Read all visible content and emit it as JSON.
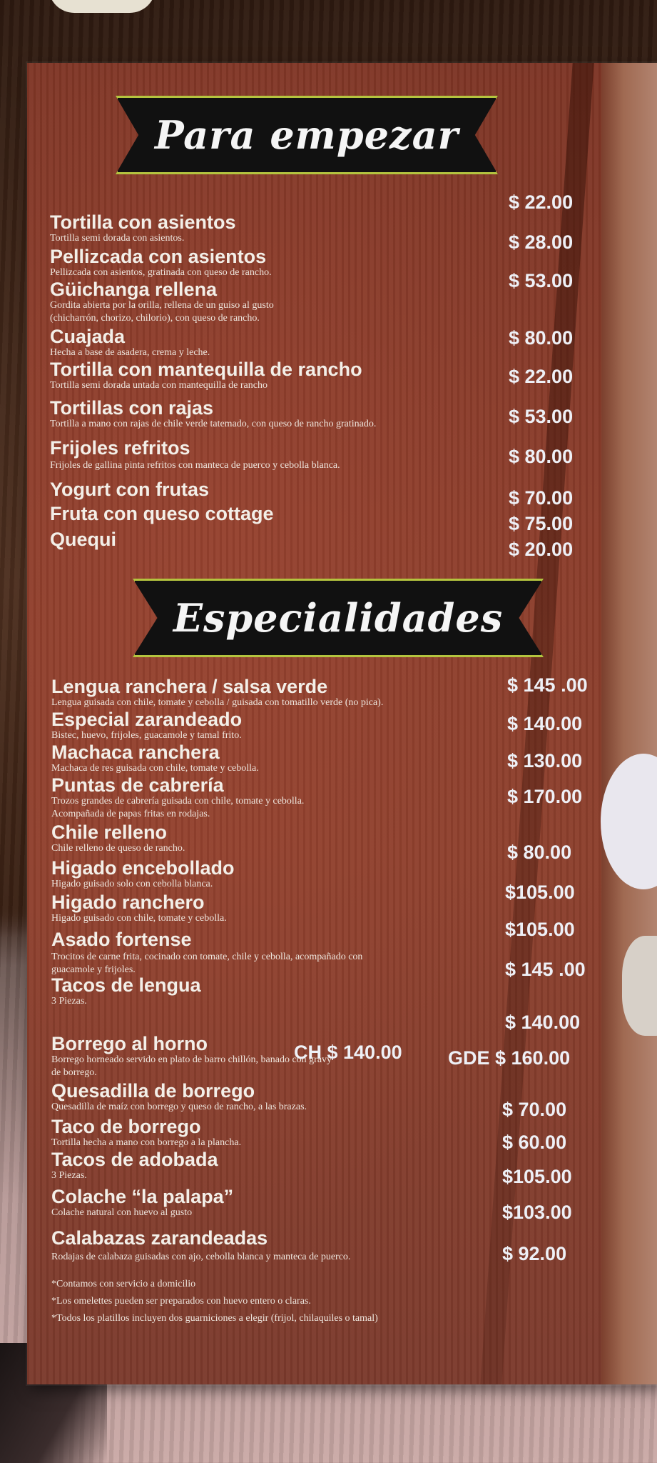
{
  "sections": [
    {
      "title": "Para empezar",
      "items": [
        {
          "name": "Tortilla con asientos",
          "desc": "Tortilla semi dorada con asientos.",
          "price": "$ 22.00"
        },
        {
          "name": "Pellizcada con asientos",
          "desc": "Pellizcada con asientos, gratinada con queso de rancho.",
          "price": "$ 28.00"
        },
        {
          "name": "Güichanga rellena",
          "desc": "Gordita abierta por la orilla, rellena de un guiso al gusto",
          "desc2": "(chicharrón, chorizo, chilorio), con queso de  rancho.",
          "price": "$ 53.00"
        },
        {
          "name": "Cuajada",
          "desc": "Hecha a base de asadera, crema y leche.",
          "price": "$ 80.00"
        },
        {
          "name": "Tortilla con mantequilla de rancho",
          "desc": "Tortilla semi dorada untada con mantequilla de rancho",
          "price": "$ 22.00"
        },
        {
          "name": "Tortillas con rajas",
          "desc": "Tortilla a mano con rajas de chile verde tatemado, con queso de rancho gratinado.",
          "price": "$ 53.00"
        },
        {
          "name": "Frijoles refritos",
          "desc": "Frijoles de gallina pinta refritos con manteca de puerco y cebolla blanca.",
          "price": "$ 80.00"
        },
        {
          "name": "Yogurt con frutas",
          "price": "$ 70.00"
        },
        {
          "name": "Fruta con queso cottage",
          "price": "$ 75.00"
        },
        {
          "name": "Quequi",
          "price": "$ 20.00"
        }
      ]
    },
    {
      "title": "Especialidades",
      "items": [
        {
          "name": "Lengua ranchera / salsa verde",
          "desc": "Lengua guisada con chile, tomate y cebolla / guisada con tomatillo verde (no pica).",
          "price": "$ 145 .00"
        },
        {
          "name": "Especial zarandeado",
          "desc": "Bistec, huevo, frijoles, guacamole y tamal frito.",
          "price": "$ 140.00"
        },
        {
          "name": "Machaca ranchera",
          "desc": "Machaca de res guisada con chile, tomate y cebolla.",
          "price": "$ 130.00"
        },
        {
          "name": "Puntas de cabrería",
          "desc": "Trozos grandes de cabrería guisada con chile, tomate y cebolla.",
          "desc2": "Acompañada de papas fritas en rodajas.",
          "price": "$ 170.00"
        },
        {
          "name": "Chile relleno",
          "desc": "Chile relleno de queso de rancho.",
          "price": "$ 80.00"
        },
        {
          "name": "Higado encebollado",
          "desc": "Higado guisado solo con cebolla blanca.",
          "price": "$105.00"
        },
        {
          "name": "Higado ranchero",
          "desc": "Higado guisado con chile, tomate y cebolla.",
          "price": "$105.00"
        },
        {
          "name": "Asado fortense",
          "desc": "Trocitos de carne frita, cocinado con tomate, chile y cebolla, acompañado con",
          "desc2": "guacamole y frijoles.",
          "price": "$ 145 .00"
        },
        {
          "name": "Tacos de lengua",
          "desc": "3 Piezas.",
          "price": "$ 140.00"
        },
        {
          "name": "Borrego al horno",
          "desc": "Borrego horneado servido en plato de barro chillón, banado con gravy",
          "desc2": "de borrego.",
          "price_ch": "CH $ 140.00",
          "price": "GDE $ 160.00"
        },
        {
          "name": "Quesadilla de borrego",
          "desc": "Quesadilla de maíz con borrego y queso de rancho, a las brazas.",
          "price": "$ 70.00"
        },
        {
          "name": "Taco de borrego",
          "desc": "Tortilla hecha a mano con borrego a la plancha.",
          "price": "$ 60.00"
        },
        {
          "name": "Tacos de adobada",
          "desc": "3 Piezas.",
          "price": "$105.00"
        },
        {
          "name": "Colache “la palapa”",
          "desc": "Colache natural con huevo al gusto",
          "price": "$103.00"
        },
        {
          "name": "Calabazas zarandeadas",
          "desc": "Rodajas de calabaza guisadas con ajo, cebolla blanca y manteca de puerco.",
          "price": "$ 92.00"
        }
      ]
    }
  ],
  "notes": [
    "*Contamos con servicio a domicilio",
    "*Los omelettes pueden ser preparados con huevo entero o claras.",
    "*Todos los platillos incluyen dos guarniciones a elegir (frijol, chilaquiles o tamal)"
  ]
}
